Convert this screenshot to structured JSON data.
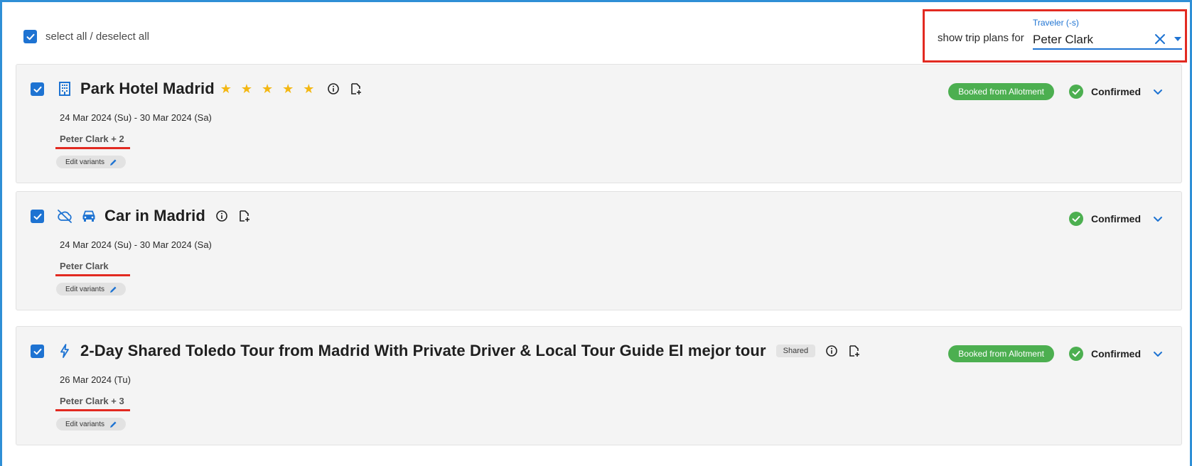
{
  "header": {
    "select_all_label": "select all / deselect all",
    "filter": {
      "prefix": "show trip plans for",
      "label": "Traveler (-s)",
      "value": "Peter Clark"
    }
  },
  "trips": [
    {
      "title": "Park Hotel Madrid",
      "type_icon": "building-icon",
      "stars": "★ ★ ★ ★ ★",
      "date": "24 Mar 2024 (Su) - 30 Mar 2024 (Sa)",
      "travelers": "Peter Clark + 2",
      "edit_label": "Edit variants",
      "badge": "Booked from Allotment",
      "status": "Confirmed"
    },
    {
      "title": "Car in Madrid",
      "type_icon": "car-icon",
      "date": "24 Mar 2024 (Su) - 30 Mar 2024 (Sa)",
      "travelers": "Peter Clark",
      "edit_label": "Edit variants",
      "status": "Confirmed"
    },
    {
      "title": "2-Day Shared Toledo Tour from Madrid With Private Driver & Local Tour Guide El mejor tour",
      "type_icon": "lightning-icon",
      "tag": "Shared",
      "date": "26 Mar 2024 (Tu)",
      "travelers": "Peter Clark + 3",
      "edit_label": "Edit variants",
      "badge": "Booked from Allotment",
      "status": "Confirmed"
    }
  ],
  "colors": {
    "accent": "#1e73d2",
    "frame": "#2f8fd6",
    "highlight": "#e22a21",
    "success": "#4caf50",
    "star": "#f3b712"
  }
}
